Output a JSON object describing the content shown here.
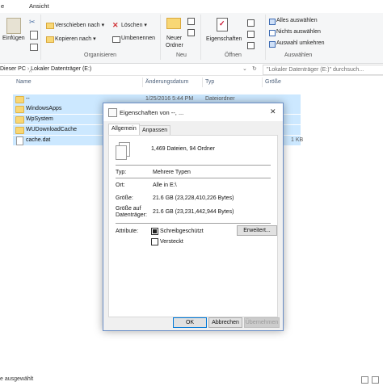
{
  "ribbon_tabs": [
    "e",
    "Ansicht"
  ],
  "ribbon": {
    "clipboard": {
      "paste": "Einfügen"
    },
    "organize": {
      "move_to": "Verschieben nach",
      "copy_to": "Kopieren nach",
      "delete": "Löschen",
      "rename": "Umbenennen",
      "label": "Organisieren"
    },
    "new": {
      "new_folder_line1": "Neuer",
      "new_folder_line2": "Ordner",
      "label": "Neu"
    },
    "open": {
      "properties": "Eigenschaften",
      "label": "Öffnen"
    },
    "select": {
      "select_all": "Alles auswählen",
      "select_none": "Nichts auswählen",
      "invert": "Auswahl umkehren",
      "label": "Auswählen"
    }
  },
  "address": {
    "path_root": "Dieser PC",
    "path_drive": "Lokaler Datenträger (E:)",
    "search_placeholder": "\"Lokaler Datenträger (E:)\" durchsuch..."
  },
  "columns": [
    "Name",
    "Änderungsdatum",
    "Typ",
    "Größe"
  ],
  "files": [
    {
      "name": "--",
      "date": "1/25/2016 5:44 PM",
      "type": "Dateiordner",
      "size": "",
      "kind": "folder"
    },
    {
      "name": "WindowsApps",
      "date": "",
      "type": "",
      "size": "",
      "kind": "folder"
    },
    {
      "name": "WpSystem",
      "date": "",
      "type": "",
      "size": "",
      "kind": "folder"
    },
    {
      "name": "WUDownloadCache",
      "date": "",
      "type": "",
      "size": "",
      "kind": "folder"
    },
    {
      "name": "cache.dat",
      "date": "",
      "type": "",
      "size": "1 KB",
      "kind": "file"
    }
  ],
  "status": "e ausgewählt",
  "dialog": {
    "title": "Eigenschaften von --, ...",
    "tabs": [
      "Allgemein",
      "Anpassen"
    ],
    "summary": "1,469 Dateien, 94 Ordner",
    "type_label": "Typ:",
    "type_value": "Mehrere Typen",
    "location_label": "Ort:",
    "location_value": "Alle in E:\\",
    "size_label": "Größe:",
    "size_value": "21.6 GB (23,228,410,226 Bytes)",
    "disk_size_label_1": "Größe auf",
    "disk_size_label_2": "Datenträger:",
    "disk_size_value": "21.6 GB (23,231,442,944 Bytes)",
    "attributes_label": "Attribute:",
    "readonly_label": "Schreibgeschützt",
    "hidden_label": "Versteckt",
    "advanced_button": "Erweitert...",
    "ok_button": "OK",
    "cancel_button": "Abbrechen",
    "apply_button": "Übernehmen"
  },
  "colors": {
    "accent": "#0078d7",
    "folder": "#f8d775",
    "selection": "#cce8ff",
    "delete_red": "#d13438"
  }
}
